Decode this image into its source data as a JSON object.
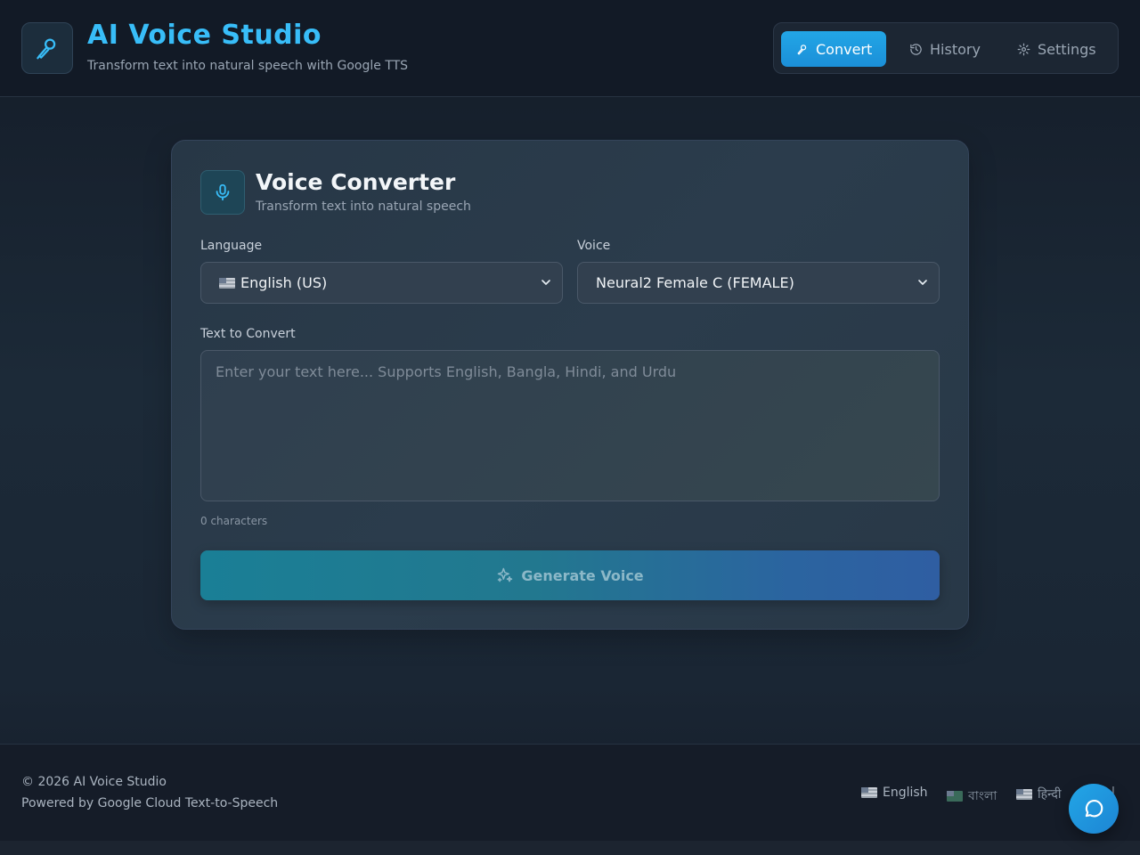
{
  "header": {
    "title": "AI Voice Studio",
    "subtitle": "Transform text into natural speech with Google TTS",
    "logo_icon": "mic-icon",
    "nav": [
      {
        "label": "Convert",
        "icon": "mic-icon",
        "active": true
      },
      {
        "label": "History",
        "icon": "history-icon",
        "active": false
      },
      {
        "label": "Settings",
        "icon": "gear-icon",
        "active": false
      }
    ]
  },
  "converter": {
    "title": "Voice Converter",
    "subtitle": "Transform text into natural speech",
    "language_label": "Language",
    "language_value": "English (US)",
    "voice_label": "Voice",
    "voice_value": "Neural2 Female C (FEMALE)",
    "text_label": "Text to Convert",
    "text_placeholder": "Enter your text here... Supports English, Bangla, Hindi, and Urdu",
    "text_value": "",
    "char_count": "0 characters",
    "generate_label": "Generate Voice"
  },
  "footer": {
    "copyright": "© 2026 AI Voice Studio",
    "powered": "Powered by Google Cloud Text-to-Speech",
    "languages": [
      "English",
      "বাংলা",
      "हिन्दी",
      "l"
    ]
  },
  "colors": {
    "accent": "#38bdf8",
    "nav_active": "#1b8fd8",
    "background": "#1c2a38"
  }
}
